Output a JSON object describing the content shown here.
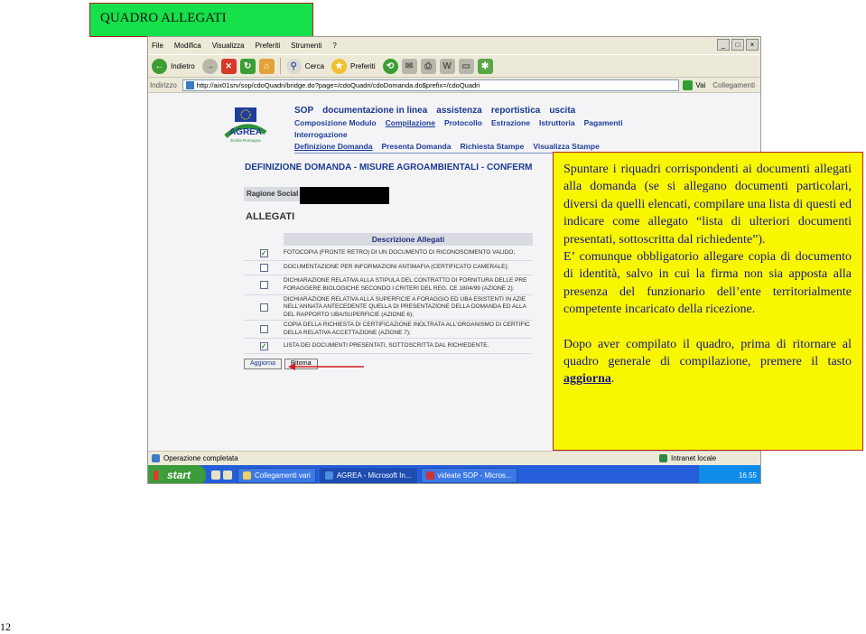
{
  "slide": {
    "title": "QUADRO ALLEGATI",
    "page_number": "12"
  },
  "browser": {
    "menu": [
      "File",
      "Modifica",
      "Visualizza",
      "Preferiti",
      "Strumenti",
      "?"
    ],
    "toolbar": {
      "back": "Indietro",
      "search": "Cerca",
      "favorites": "Preferiti"
    },
    "address": {
      "label": "Indirizzo",
      "url": "http://aix01srv/sop/cdoQuadri/bridge.do?page=/cdoQuadri/cdoDomanda.do$prefix=/cdoQuadri",
      "go": "Vai",
      "links": "Collegamenti"
    },
    "status": {
      "left": "Operazione completata",
      "zone": "Intranet locale"
    }
  },
  "app": {
    "brand_name": "AGREA",
    "brand_sub": "Emilia-Romagna",
    "nav_top": [
      "SOP",
      "documentazione in linea",
      "assistenza",
      "reportistica",
      "uscita"
    ],
    "nav_row2": [
      "Composizione Modulo",
      "Compilazione",
      "Protocollo",
      "Estrazione",
      "Istruttoria",
      "Pagamenti"
    ],
    "nav_row3": [
      "Interrogazione"
    ],
    "nav_row4": [
      "Definizione Domanda",
      "Presenta Domanda",
      "Richiesta Stampe",
      "Visualizza Stampe"
    ],
    "form_heading": "DEFINIZIONE DOMANDA - MISURE AGROAMBIENTALI - CONFERM",
    "ragione_label": "Ragione Social",
    "section_title": "ALLEGATI",
    "grid_header": "Descrizione Allegati",
    "attachments": [
      {
        "checked": true,
        "text": "FOTOCOPIA (FRONTE RETRO) DI UN DOCUMENTO DI RICONOSCIMENTO VALIDO;"
      },
      {
        "checked": false,
        "text": "DOCUMENTAZIONE PER INFORMAZIONI ANTIMAFIA (CERTIFICATO CAMERALE);"
      },
      {
        "checked": false,
        "text": "DICHIARAZIONE RELATIVA ALLA STIPULA DEL CONTRATTO DI FORNITURA DELLE PRE\nFORAGGERE BIOLOGICHE SECONDO I CRITERI DEL REG. CE 1804/99 (AZIONE 2);"
      },
      {
        "checked": false,
        "text": "DICHIARAZIONE RELATIVA ALLA SUPERFICIE A FORAGGIO ED UBA ESISTENTI IN AZIE\nNELL'ANNATA ANTECEDENTE QUELLA DI PRESENTAZIONE DELLA DOMANDA ED ALLA\nDEL RAPPORTO UBA/SUPERFICIE (AZIONE 6);"
      },
      {
        "checked": false,
        "text": "COPIA DELLA RICHIESTA DI CERTIFICAZIONE INOLTRATA ALL'ORGANISMO DI CERTIFIC\nDELLA RELATIVA ACCETTAZIONE (AZIONE 7);"
      },
      {
        "checked": true,
        "text": "LISTA DEI DOCUMENTI PRESENTATI, SOTTOSCRITTA DAL RICHIEDENTE."
      }
    ],
    "buttons": {
      "update": "Aggiorna",
      "back": "Ritorna"
    }
  },
  "taskbar": {
    "start": "start",
    "tasks": [
      "Collegamenti vari",
      "AGREA - Microsoft In...",
      "videate SOP - Micros..."
    ],
    "clock": "16.55"
  },
  "callout": {
    "p1": "Spuntare i riquadri corrispondenti ai documenti allegati alla domanda (se si allegano documenti particolari, diversi da quelli elencati, compilare una lista di questi ed indicare come allegato “lista di ulteriori documenti presentati, sottoscritta dal richiedente”).",
    "p2": "E’ comunque obbligatorio allegare copia di documento di identità, salvo in cui la firma non sia apposta alla presenza del funzionario dell’ente territorialmente competente incaricato della ricezione.",
    "p3_before": "Dopo aver compilato il quadro, prima di ritornare al quadro generale di compilazione, premere il tasto ",
    "p3_highlight": "aggiorna",
    "p3_after": "."
  }
}
